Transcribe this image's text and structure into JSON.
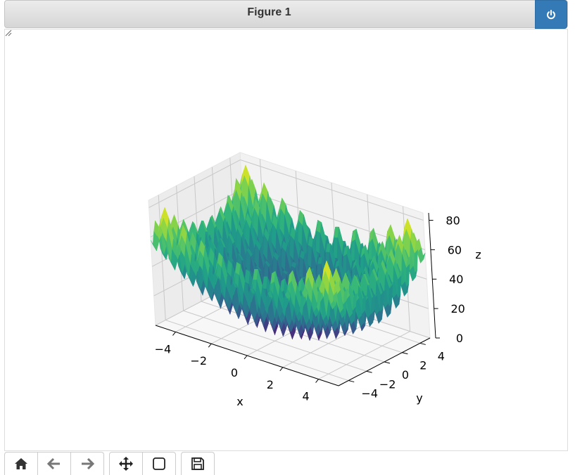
{
  "window": {
    "title": "Figure 1"
  },
  "toolbar": {
    "buttons": [
      {
        "name": "home-button",
        "icon": "home-icon"
      },
      {
        "name": "back-button",
        "icon": "arrow-left-icon"
      },
      {
        "name": "forward-button",
        "icon": "arrow-right-icon"
      },
      {
        "name": "pan-button",
        "icon": "move-icon"
      },
      {
        "name": "zoom-button",
        "icon": "zoom-rect-icon"
      },
      {
        "name": "save-button",
        "icon": "save-icon"
      }
    ]
  },
  "chart_data": {
    "type": "surface3d",
    "colormap": "viridis",
    "function": "rastrigin-like: 20 + x^2 + y^2 - 10cos(2πx) - 10cos(2πy)",
    "x_range": [
      -5.12,
      5.12
    ],
    "y_range": [
      -5.12,
      5.12
    ],
    "z_range": [
      0,
      85
    ],
    "xlabel": "x",
    "ylabel": "y",
    "zlabel": "z",
    "x_ticks": [
      "−4",
      "−2",
      "0",
      "2",
      "4"
    ],
    "y_ticks": [
      "−4",
      "−2",
      "0",
      "2",
      "4"
    ],
    "z_ticks": [
      "0",
      "20",
      "40",
      "60",
      "80"
    ],
    "grid": true
  },
  "colors": {
    "accent": "#337ab7"
  }
}
